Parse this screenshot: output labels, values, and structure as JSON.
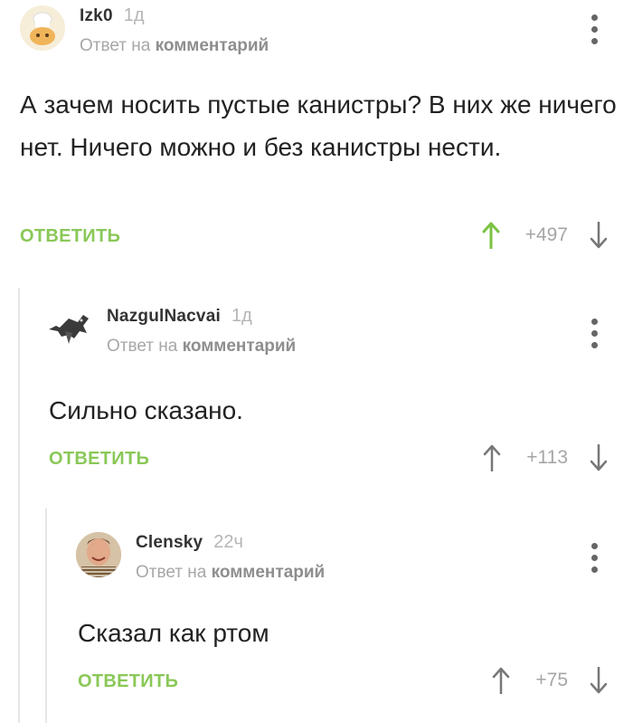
{
  "comments": [
    {
      "author": "Izk0",
      "time": "1д",
      "reply_prefix": "Ответ на",
      "reply_target": "комментарий",
      "text": "А зачем носить пустые канистры? В них же ничего нет. Ничего можно и без канистры нести.",
      "reply_label": "ОТВЕТИТЬ",
      "score": "+497",
      "avatar_icon": "chef-cartoon-avatar-icon",
      "upvote_active": true
    },
    {
      "author": "NazgulNacvai",
      "time": "1д",
      "reply_prefix": "Ответ на",
      "reply_target": "комментарий",
      "text": "Сильно сказано.",
      "reply_label": "ОТВЕТИТЬ",
      "score": "+113",
      "avatar_icon": "winged-dragon-avatar-icon",
      "upvote_active": false
    },
    {
      "author": "Clensky",
      "time": "22ч",
      "reply_prefix": "Ответ на",
      "reply_target": "комментарий",
      "text": "Сказал как ртом",
      "reply_label": "ОТВЕТИТЬ",
      "score": "+75",
      "avatar_icon": "portrait-photo-avatar-icon",
      "upvote_active": false
    }
  ],
  "colors": {
    "accent_green": "#8ac858",
    "upvote_active": "#7cc242",
    "muted": "#a7a7a7"
  }
}
